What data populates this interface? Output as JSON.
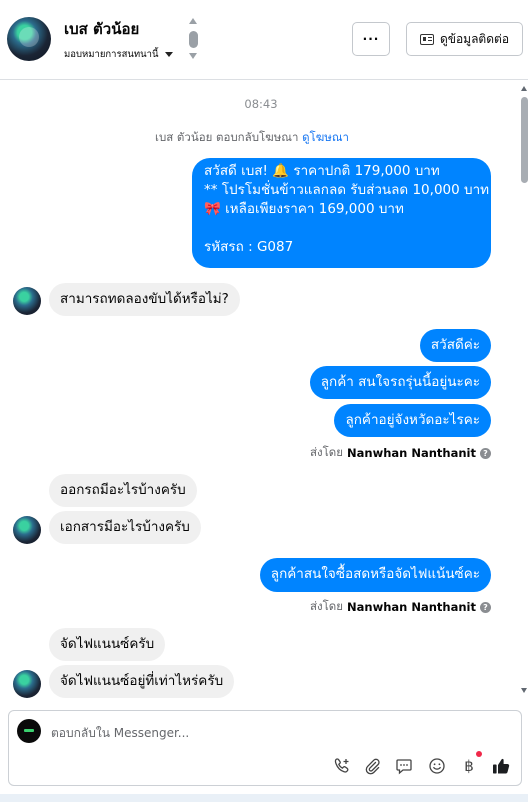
{
  "header": {
    "contact_name": "เบส ตัวน้อย",
    "assign_label": "มอบหมายการสนทนานี้",
    "more_label": "···",
    "contact_info_label": "ดูข้อมูลติดต่อ"
  },
  "thread": {
    "timestamp": "08:43",
    "ad_reply_prefix": "เบส ตัวน้อย ตอบกลับโฆษณา",
    "ad_reply_link": "ดูโฆษณา",
    "ad_message": {
      "line1": "สวัสดี เบส! 🔔 ราคาปกติ 179,000 บาท",
      "line2": "** โปรโมชั่นข้าวแลกลด รับส่วนลด 10,000 บาท",
      "line3": "🎀 เหลือเพียงราคา 169,000 บาท",
      "line4": "",
      "line5": "รหัสรถ : G087"
    },
    "messages": [
      {
        "dir": "in",
        "text": "สามารถทดลองขับได้หรือไม่?"
      },
      {
        "dir": "out",
        "text": "สวัสดีค่ะ"
      },
      {
        "dir": "out",
        "text": "ลูกค้า สนใจรถรุ่นนี้อยู่นะคะ"
      },
      {
        "dir": "out",
        "text": "ลูกค้าอยู่จังหวัดอะไรคะ"
      },
      {
        "dir": "in",
        "text": "ออกรถมีอะไรบ้างครับ"
      },
      {
        "dir": "in",
        "text": "เอกสารมีอะไรบ้างครับ"
      },
      {
        "dir": "out",
        "text": "ลูกค้าสนใจซื้อสดหรือจัดไฟแน้นซ์คะ"
      },
      {
        "dir": "in",
        "text": "จัดไฟแนนซ์ครับ"
      },
      {
        "dir": "in",
        "text": "จัดไฟแนนซ์อยู่ที่เท่าไหร่ครับ"
      }
    ],
    "sent_by_prefix": "ส่งโดย",
    "sent_by_name": "Nanwhan Nanthanit",
    "help_glyph": "?"
  },
  "composer": {
    "placeholder": "ตอบกลับใน Messenger...",
    "icons": [
      "phone-plus-icon",
      "attach-icon",
      "saved-reply-icon",
      "emoji-icon",
      "baht-icon",
      "like-icon"
    ],
    "baht_glyph": "฿"
  },
  "colors": {
    "outgoing_bubble": "#0084ff",
    "incoming_bubble": "#f0f0f0",
    "link": "#1877f2"
  }
}
